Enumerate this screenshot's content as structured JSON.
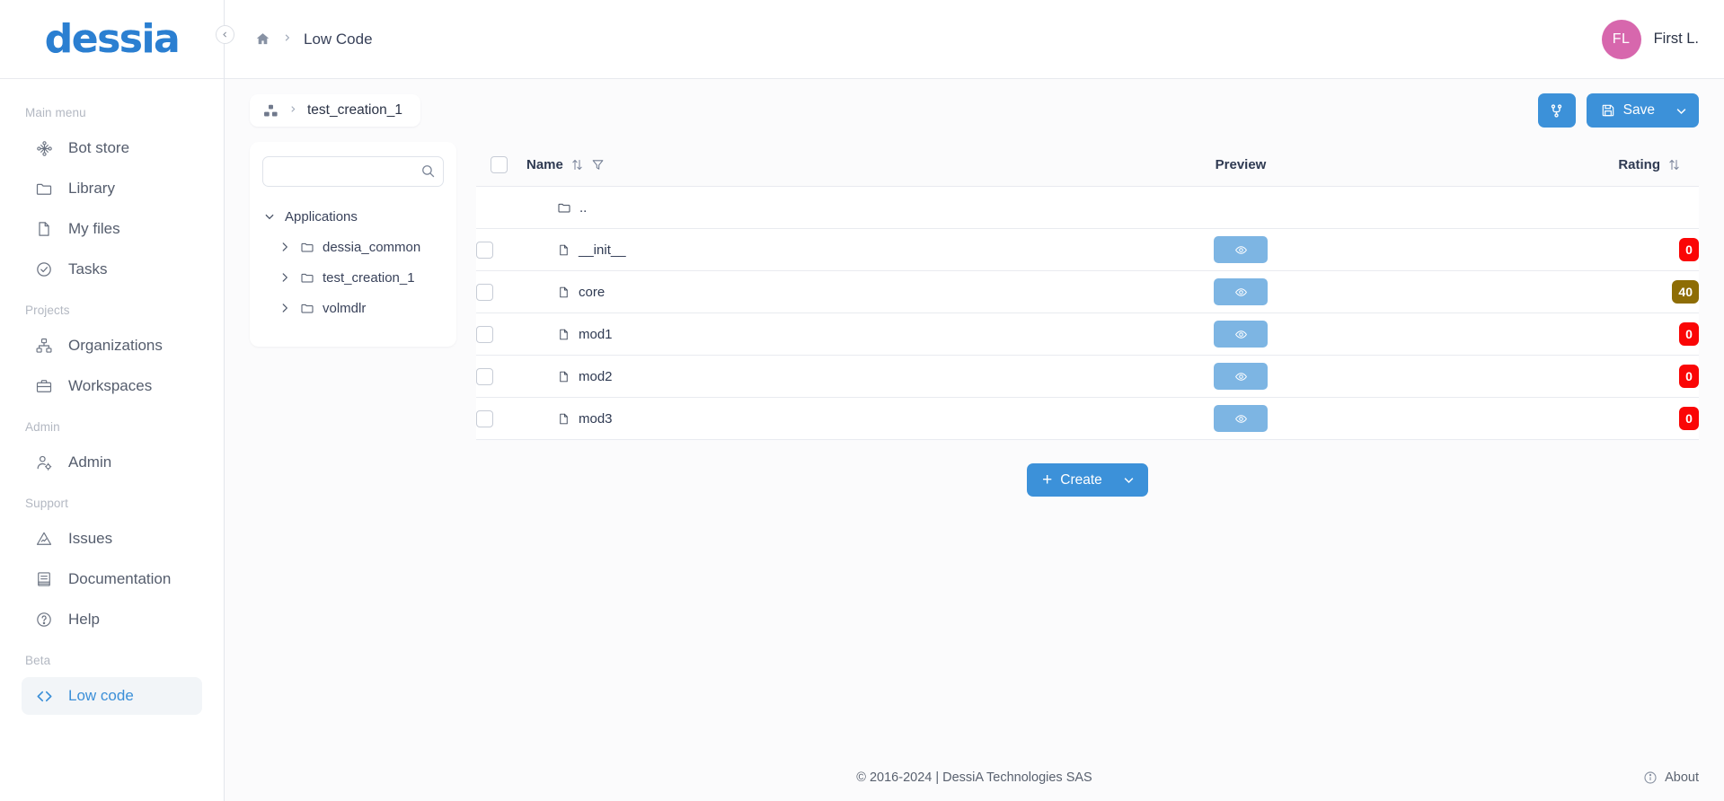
{
  "brand": {
    "logo_text": "dessia"
  },
  "sidebar": {
    "collapse_icon": "chevron-left-icon",
    "sections": [
      {
        "label": "Main menu",
        "items": [
          {
            "label": "Bot store",
            "icon": "bot-store-icon",
            "active": false
          },
          {
            "label": "Library",
            "icon": "folder-icon",
            "active": false
          },
          {
            "label": "My files",
            "icon": "file-icon",
            "active": false
          },
          {
            "label": "Tasks",
            "icon": "check-circle-icon",
            "active": false
          }
        ]
      },
      {
        "label": "Projects",
        "items": [
          {
            "label": "Organizations",
            "icon": "org-chart-icon",
            "active": false
          },
          {
            "label": "Workspaces",
            "icon": "briefcase-icon",
            "active": false
          }
        ]
      },
      {
        "label": "Admin",
        "items": [
          {
            "label": "Admin",
            "icon": "user-gear-icon",
            "active": false
          }
        ]
      },
      {
        "label": "Support",
        "items": [
          {
            "label": "Issues",
            "icon": "alert-triangle-icon",
            "active": false
          },
          {
            "label": "Documentation",
            "icon": "book-icon",
            "active": false
          },
          {
            "label": "Help",
            "icon": "question-circle-icon",
            "active": false
          }
        ]
      },
      {
        "label": "Beta",
        "items": [
          {
            "label": "Low code",
            "icon": "code-brackets-icon",
            "active": true
          }
        ]
      }
    ]
  },
  "topbar": {
    "home_icon": "home-icon",
    "separator": "›",
    "breadcrumb_label": "Low Code",
    "user": {
      "initials": "FL",
      "name": "First L.",
      "avatar_color": "#d767ad"
    }
  },
  "toolbar": {
    "path": {
      "icon": "cubes-icon",
      "separator": "›",
      "name": "test_creation_1"
    },
    "branch_button": {
      "icon": "git-branch-icon",
      "label": ""
    },
    "save_button": {
      "icon": "save-disk-icon",
      "label": "Save",
      "caret_icon": "chevron-down-icon"
    }
  },
  "tree": {
    "search": {
      "value": "",
      "placeholder": "",
      "icon": "search-icon"
    },
    "root": {
      "label": "Applications",
      "expanded": true,
      "icon": "chevron-down-icon"
    },
    "children": [
      {
        "label": "dessia_common",
        "expanded": false,
        "chevron": "chevron-right-icon",
        "icon": "folder-icon"
      },
      {
        "label": "test_creation_1",
        "expanded": false,
        "chevron": "chevron-right-icon",
        "icon": "folder-icon"
      },
      {
        "label": "volmdlr",
        "expanded": false,
        "chevron": "chevron-right-icon",
        "icon": "folder-icon"
      }
    ]
  },
  "table": {
    "columns": {
      "name": "Name",
      "preview": "Preview",
      "rating": "Rating"
    },
    "header_icons": {
      "sort": "sort-updown-icon",
      "filter": "funnel-icon",
      "select_all": "checkbox-unchecked"
    },
    "rows": [
      {
        "name": "..",
        "icon": "folder-icon",
        "type": "up",
        "has_checkbox": false,
        "has_preview": false,
        "rating": null,
        "rating_color": null
      },
      {
        "name": "__init__",
        "icon": "file-icon",
        "type": "file",
        "has_checkbox": true,
        "has_preview": true,
        "rating": "0",
        "rating_color": "#fa0606"
      },
      {
        "name": "core",
        "icon": "file-icon",
        "type": "file",
        "has_checkbox": true,
        "has_preview": true,
        "rating": "40",
        "rating_color": "#8e6d05"
      },
      {
        "name": "mod1",
        "icon": "file-icon",
        "type": "file",
        "has_checkbox": true,
        "has_preview": true,
        "rating": "0",
        "rating_color": "#fa0606"
      },
      {
        "name": "mod2",
        "icon": "file-icon",
        "type": "file",
        "has_checkbox": true,
        "has_preview": true,
        "rating": "0",
        "rating_color": "#fa0606"
      },
      {
        "name": "mod3",
        "icon": "file-icon",
        "type": "file",
        "has_checkbox": true,
        "has_preview": true,
        "rating": "0",
        "rating_color": "#fa0606"
      }
    ],
    "preview_button": {
      "icon": "eye-icon"
    },
    "create_button": {
      "plus": "+",
      "label": "Create",
      "caret_icon": "chevron-down-icon"
    }
  },
  "footer": {
    "copyright": "© 2016-2024 | DessiA Technologies SAS",
    "about": {
      "label": "About",
      "icon": "info-circle-icon"
    }
  },
  "colors": {
    "accent_blue": "#3c91d9",
    "preview_blue": "#7db5e3",
    "brand_blue": "#2b7fd1",
    "avatar_pink": "#d767ad",
    "badge_red": "#fa0606",
    "badge_gold": "#8e6d05"
  }
}
